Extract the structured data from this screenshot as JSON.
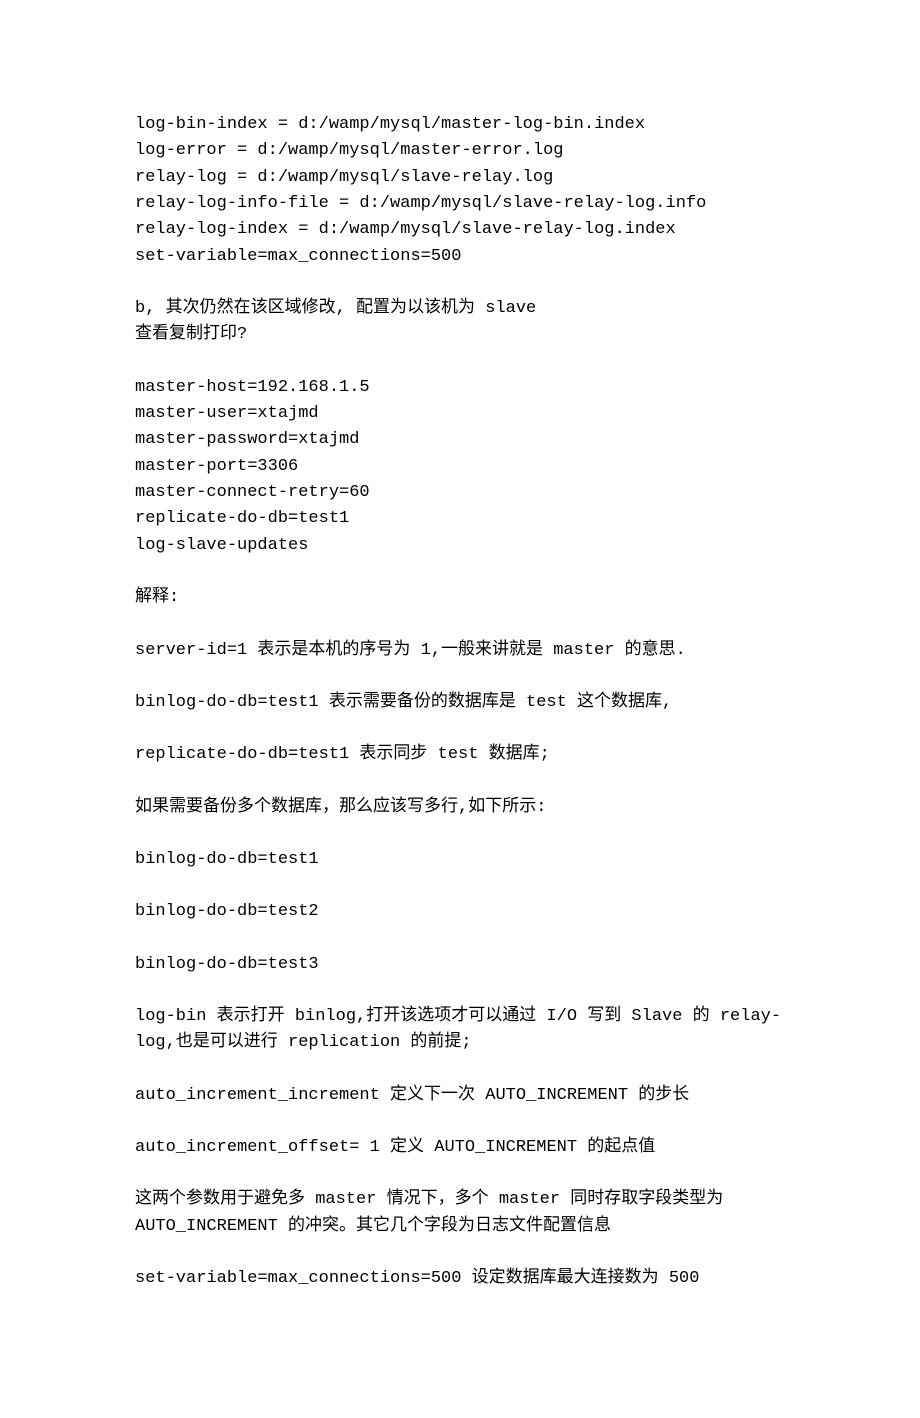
{
  "config_block_1": {
    "l1": "log-bin-index = d:/wamp/mysql/master-log-bin.index",
    "l2": "log-error = d:/wamp/mysql/master-error.log",
    "l3": "relay-log = d:/wamp/mysql/slave-relay.log",
    "l4": "relay-log-info-file = d:/wamp/mysql/slave-relay-log.info",
    "l5": "relay-log-index = d:/wamp/mysql/slave-relay-log.index",
    "l6": "set-variable=max_connections=500"
  },
  "section_b": {
    "l1": "b,  其次仍然在该区域修改, 配置为以该机为 slave",
    "l2": "查看复制打印?"
  },
  "config_block_2": {
    "l1": "master-host=192.168.1.5",
    "l2": "master-user=xtajmd",
    "l3": "master-password=xtajmd",
    "l4": "master-port=3306",
    "l5": "master-connect-retry=60",
    "l6": "replicate-do-db=test1",
    "l7": "log-slave-updates"
  },
  "explain_heading": "解释:",
  "p_server_id": "server-id=1 表示是本机的序号为 1,一般来讲就是 master 的意思.",
  "p_binlog_do_db": "binlog-do-db=test1 表示需要备份的数据库是 test 这个数据库,",
  "p_replicate_do_db": "replicate-do-db=test1 表示同步 test 数据库;",
  "p_multi_db": "如果需要备份多个数据库，那么应该写多行,如下所示:",
  "p_bin1": "binlog-do-db=test1",
  "p_bin2": "binlog-do-db=test2",
  "p_bin3": "binlog-do-db=test3",
  "p_logbin": "log-bin 表示打开 binlog,打开该选项才可以通过 I/O 写到 Slave 的 relay-log,也是可以进行 replication 的前提;",
  "p_auto_inc": "auto_increment_increment 定义下一次 AUTO_INCREMENT 的步长",
  "p_auto_off": "auto_increment_offset= 1 定义 AUTO_INCREMENT 的起点值",
  "p_conflict": "这两个参数用于避免多 master 情况下，多个 master 同时存取字段类型为AUTO_INCREMENT 的冲突。其它几个字段为日志文件配置信息",
  "p_maxconn": "set-variable=max_connections=500 设定数据库最大连接数为 500"
}
